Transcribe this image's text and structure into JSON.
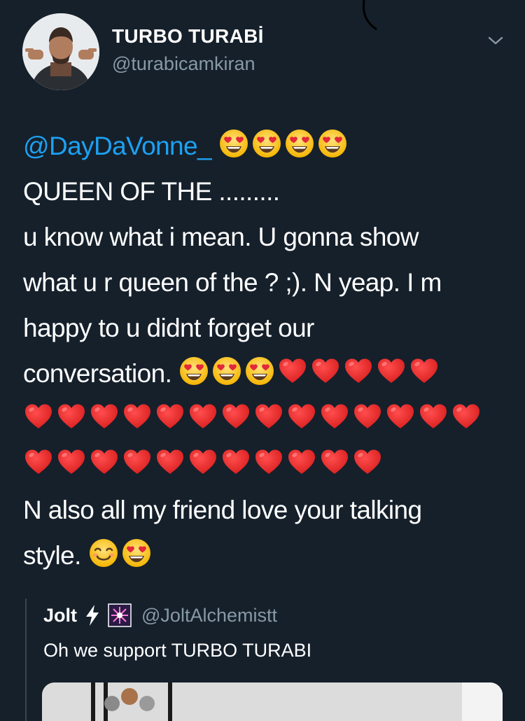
{
  "tweet": {
    "author_name": "TURBO TURABİ",
    "author_handle": "@turabicamkiran",
    "avatar_icon": "user-avatar",
    "menu_icon": "chevron-down-icon",
    "mention": "@DayDaVonne_",
    "lines": [
      "QUEEN OF THE .........",
      "u know what i mean. U gonna show",
      "what u r queen of the ? ;). N yeap. I m",
      "happy to u didnt forget our",
      "conversation.",
      "N also all my friend love your talking",
      "style."
    ],
    "emoji": {
      "mention_row": [
        "heart-eyes",
        "heart-eyes",
        "heart-eyes",
        "heart-eyes"
      ],
      "conversation_row": [
        "heart-eyes",
        "heart-eyes",
        "heart-eyes",
        "red-heart",
        "red-heart",
        "red-heart",
        "red-heart",
        "red-heart"
      ],
      "hearts_row_1_count": 14,
      "hearts_row_2_count": 11,
      "style_row": [
        "smiling-face",
        "heart-eyes"
      ]
    }
  },
  "quoted_tweet": {
    "author_name": "Jolt",
    "author_icons": [
      "lightning-bolt-icon",
      "sparkle-box-icon"
    ],
    "author_handle": "@JoltAlchemistt",
    "text": "Oh we support TURBO TURABI"
  },
  "colors": {
    "background": "#15202b",
    "text": "#ffffff",
    "secondary_text": "#8899a6",
    "link": "#1da1f2",
    "divider": "#38444d"
  }
}
